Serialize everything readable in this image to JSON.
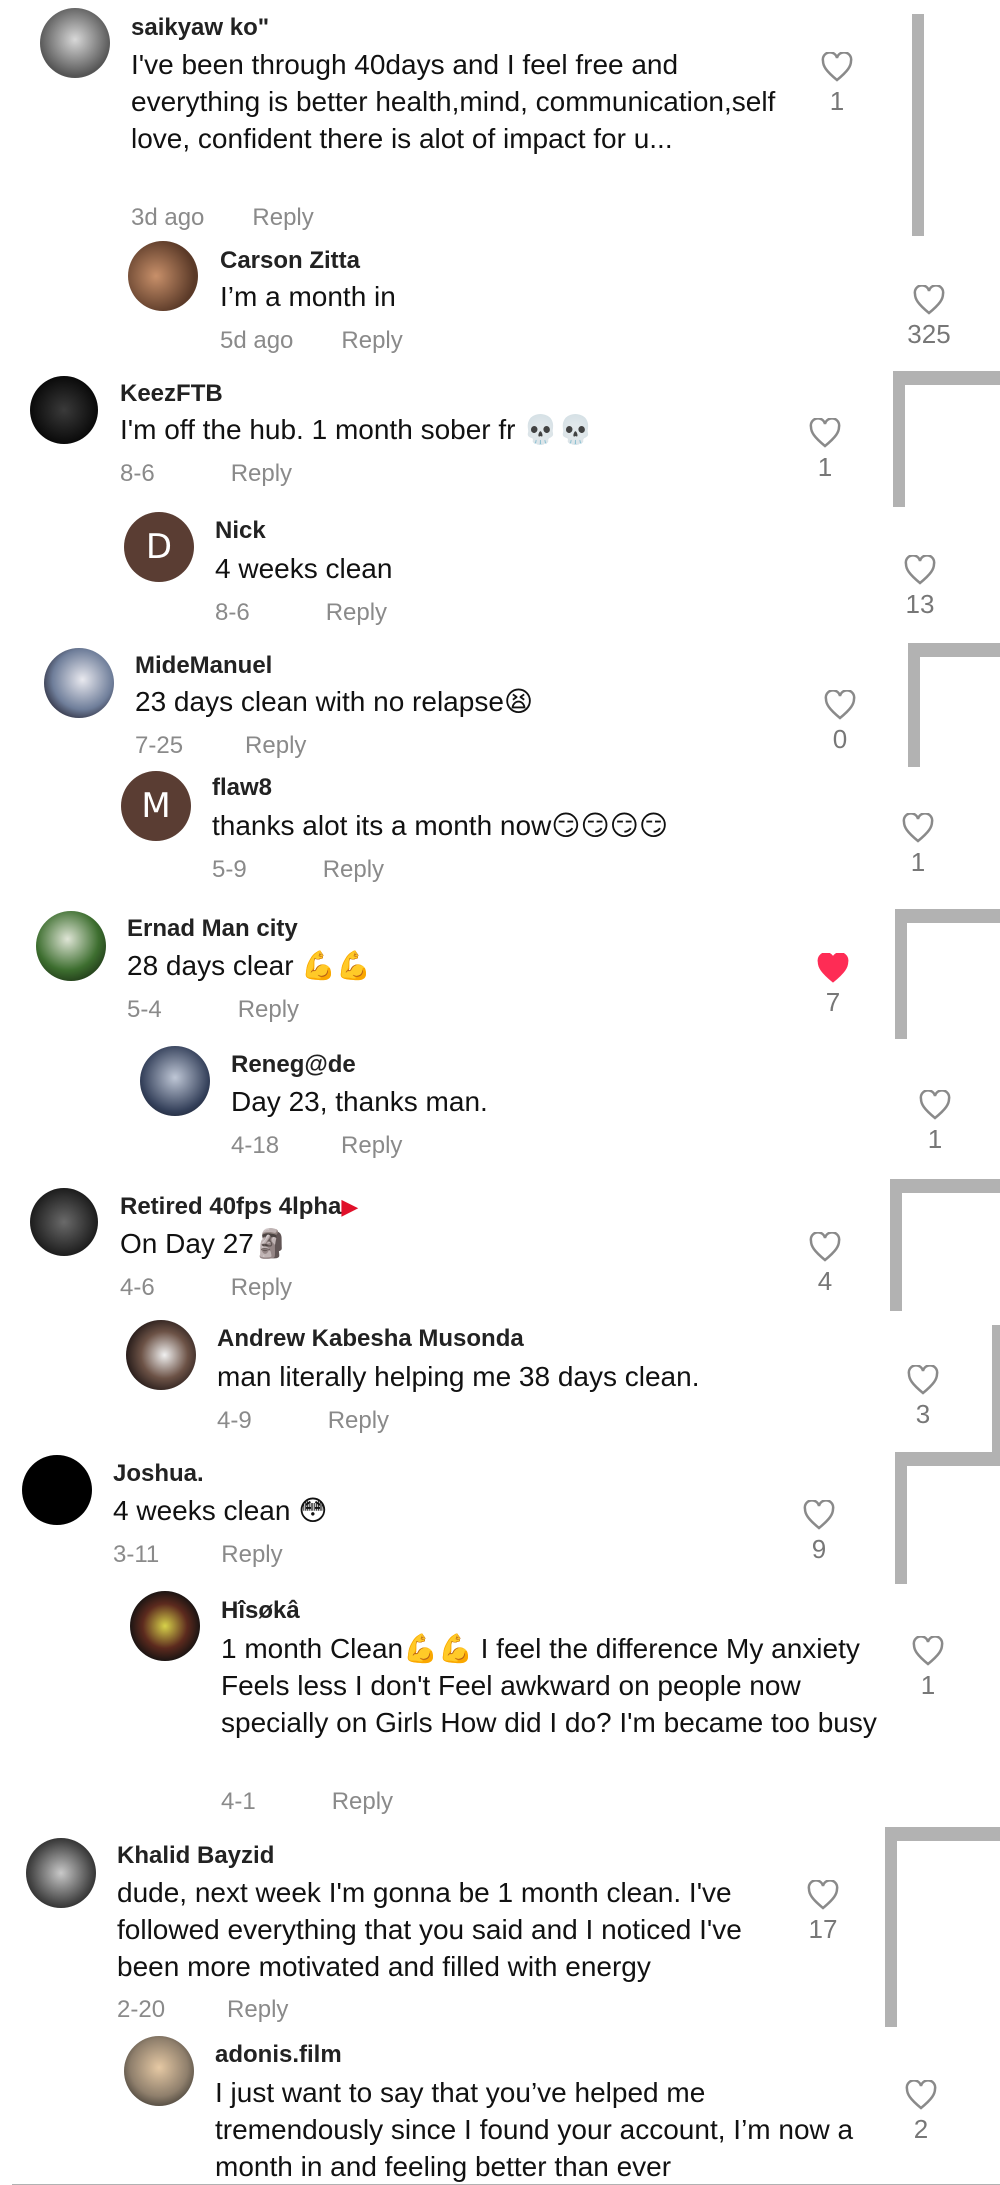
{
  "comments": [
    {
      "user": "saikyaw ko\"",
      "text": "I've been through 40days and I feel free and everything is better health,mind, communication,self love, confident there is alot of impact for u...",
      "date": "3d ago",
      "reply": "Reply",
      "likes": "1",
      "liked": false
    },
    {
      "user": "Carson Zitta",
      "text": "I’m a month in",
      "date": "5d ago",
      "reply": "Reply",
      "likes": "325",
      "liked": false
    },
    {
      "user": "KeezFTB",
      "text": "I'm off the hub. 1 month sober fr 💀💀",
      "date": "8-6",
      "reply": "Reply",
      "likes": "1",
      "liked": false
    },
    {
      "user": "Nick",
      "avatar_letter": "D",
      "text": "4 weeks clean",
      "date": "8-6",
      "reply": "Reply",
      "likes": "13",
      "liked": false
    },
    {
      "user": "MideManuel",
      "text": "23 days clean with no relapse😫",
      "date": "7-25",
      "reply": "Reply",
      "likes": "0",
      "liked": false
    },
    {
      "user": "flaw8",
      "avatar_letter": "M",
      "text": "thanks alot its a month now😏😏😏😏",
      "date": "5-9",
      "reply": "Reply",
      "likes": "1",
      "liked": false
    },
    {
      "user": "Ernad Man city",
      "text": "28 days clear 💪💪",
      "date": "5-4",
      "reply": "Reply",
      "likes": "7",
      "liked": true
    },
    {
      "user": "Reneg@de",
      "text": "Day 23, thanks man.",
      "date": "4-18",
      "reply": "Reply",
      "likes": "1",
      "liked": false
    },
    {
      "user": "Retired 40fps 4lpha",
      "user_flag": "▶",
      "text": "On Day 27🗿",
      "date": "4-6",
      "reply": "Reply",
      "likes": "4",
      "liked": false
    },
    {
      "user": "Andrew Kabesha Musonda",
      "text": "man literally helping me 38 days clean.",
      "date": "4-9",
      "reply": "Reply",
      "likes": "3",
      "liked": false
    },
    {
      "user": "Joshua.",
      "text": "4 weeks clean 😳",
      "date": "3-11",
      "reply": "Reply",
      "likes": "9",
      "liked": false
    },
    {
      "user": "Hîsøkâ",
      "text": "1 month Clean💪💪 I feel the difference My anxiety Feels less I don't Feel awkward on people now specially on Girls How did I do? I'm became too busy",
      "date": "4-1",
      "reply": "Reply",
      "likes": "1",
      "liked": false
    },
    {
      "user": "Khalid Bayzid",
      "text": "dude, next week I'm gonna be 1 month clean. I've followed everything that you said and I noticed I've been more motivated and filled with energy",
      "date": "2-20",
      "reply": "Reply",
      "likes": "17",
      "liked": false
    },
    {
      "user": "adonis.film",
      "text": "I just want to say that you’ve helped me tremendously since I found your account, I’m now a month in and feeling better than ever",
      "date": "",
      "reply": "",
      "likes": "2",
      "liked": false
    }
  ],
  "colors": {
    "liked": "#fe2c55",
    "muted": "#8a8a8a",
    "letter_avatar_1": "#5a3d33",
    "letter_avatar_2": "#5a3d33"
  },
  "icons": {
    "like": "heart-outline-icon",
    "liked": "heart-filled-icon"
  }
}
